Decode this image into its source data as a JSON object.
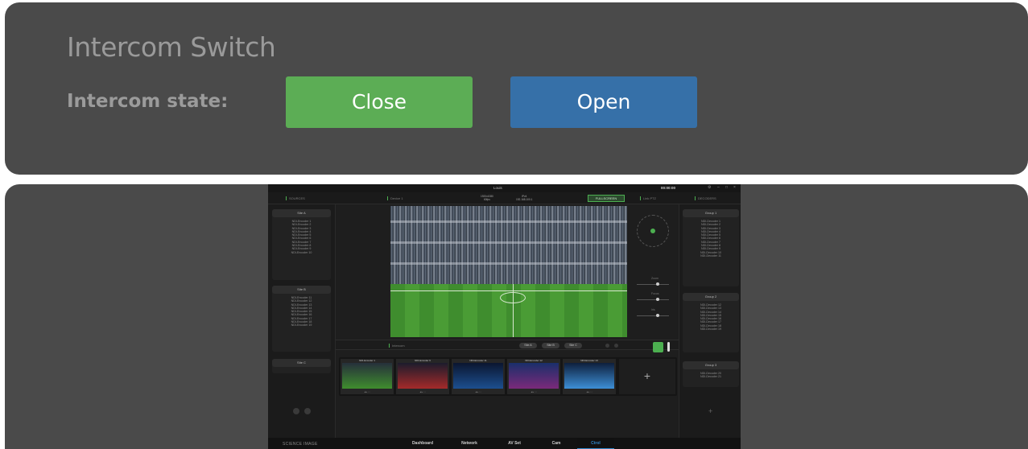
{
  "intercom": {
    "title": "Intercom Switch",
    "state_label": "Intercom state:",
    "close_label": "Close",
    "open_label": "Open",
    "close_color": "#5cad55",
    "open_color": "#3670a8"
  },
  "app": {
    "window_title": "Louis",
    "clock": "00:00:00",
    "header": {
      "sources": "SOURCES",
      "device": "Device 1",
      "meta1_a": "1920x1080",
      "meta1_b": "60fps",
      "meta2_a": "IPv4",
      "meta2_b": "192.168.100.1",
      "fullscreen": "FULLSCREEN",
      "link_ptz": "Link PTZ",
      "decoders": "DECODERS"
    },
    "left_groups": [
      {
        "name": "Site A",
        "items": [
          "NDI-Encoder 1",
          "NDI-Encoder 2",
          "NDI-Encoder 3",
          "NDI-Encoder 4",
          "NDI-Encoder 5",
          "NDI-Encoder 6",
          "NDI-Encoder 7",
          "NDI-Encoder 8",
          "NDI-Encoder 9",
          "NDI-Encoder 10"
        ]
      },
      {
        "name": "Site B",
        "items": [
          "NDI-Encoder 11",
          "NDI-Encoder 12",
          "NDI-Encoder 13",
          "NDI-Encoder 14",
          "NDI-Encoder 15",
          "NDI-Encoder 16",
          "NDI-Encoder 17",
          "NDI-Encoder 18",
          "NDI-Encoder 19"
        ]
      },
      {
        "name": "Site C",
        "items": []
      }
    ],
    "right_groups": [
      {
        "name": "Group 1",
        "items": [
          "NDI-Decoder 1",
          "NDI-Decoder 2",
          "NDI-Decoder 3",
          "NDI-Decoder 4",
          "NDI-Decoder 5",
          "NDI-Decoder 6",
          "NDI-Decoder 7",
          "NDI-Decoder 8",
          "NDI-Decoder 9",
          "NDI-Decoder 10",
          "NDI-Decoder 11"
        ]
      },
      {
        "name": "Group 2",
        "items": [
          "NDI-Decoder 12",
          "NDI-Decoder 13",
          "NDI-Decoder 14",
          "NDI-Decoder 15",
          "NDI-Decoder 16",
          "NDI-Decoder 17",
          "NDI-Decoder 18",
          "NDI-Decoder 19"
        ]
      },
      {
        "name": "Group 3",
        "items": [
          "NDI-Decoder 20",
          "NDI-Decoder 21"
        ]
      }
    ],
    "ptz": {
      "zoom_label": "Zoom",
      "focus_label": "Focus",
      "iris_label": "Iris"
    },
    "subbar": {
      "label": "Intercom",
      "site_a": "Site A",
      "site_b": "Site B",
      "site_c": "Site C"
    },
    "thumbs": [
      {
        "label": "NDI-Encoder 1",
        "colors": [
          "#3f8d2e",
          "#26303b"
        ]
      },
      {
        "label": "NDI-Encoder 6",
        "colors": [
          "#a52a2a",
          "#1c1c2c"
        ]
      },
      {
        "label": "NDI-Encoder 11",
        "colors": [
          "#1c4f8f",
          "#0b1630"
        ]
      },
      {
        "label": "NDI-Encoder 12",
        "colors": [
          "#7b2a7a",
          "#1a2f6a"
        ]
      },
      {
        "label": "NDI-Encoder 13",
        "colors": [
          "#3d8fd6",
          "#0e1f3c"
        ]
      }
    ],
    "nav": {
      "brand": "SCIENCE IMAGE",
      "tabs": [
        "Dashboard",
        "Network",
        "AV Set",
        "Cam",
        "Ctrol"
      ],
      "active_tab": "Ctrol",
      "active_color": "#2f86c9"
    }
  }
}
